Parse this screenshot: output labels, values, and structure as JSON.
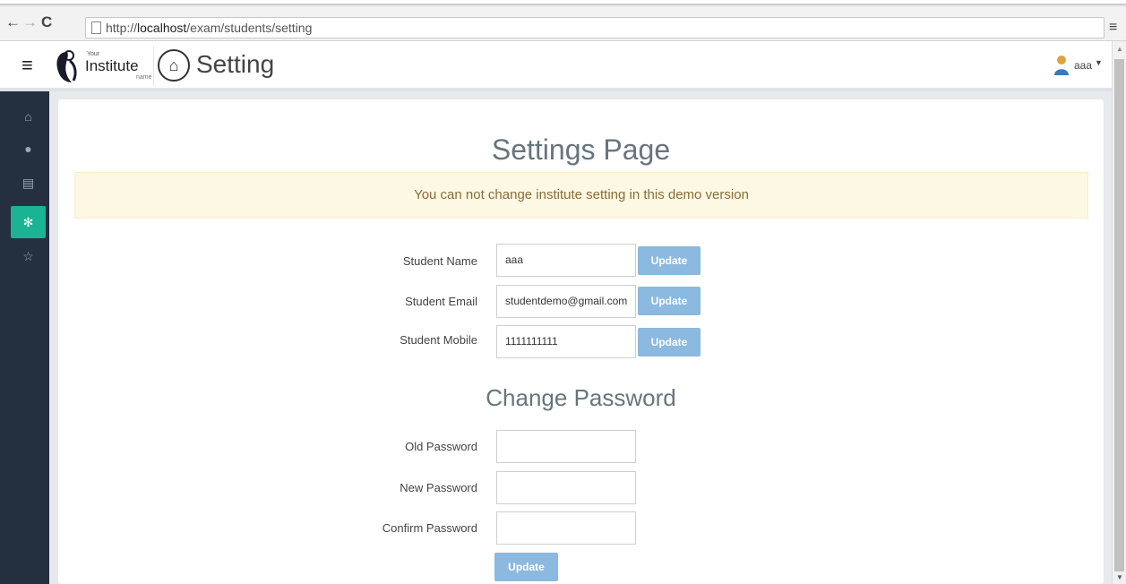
{
  "browser": {
    "url_prefix": "http://",
    "url_host": "localhost",
    "url_path": "/exam/students/setting"
  },
  "header": {
    "logo_top": "Your",
    "logo_name": "Institute",
    "logo_sub": "name",
    "page_title": "Setting",
    "user_name": "aaa"
  },
  "sidebar": {
    "items": [
      {
        "icon": "home-icon",
        "glyph": "⌂"
      },
      {
        "icon": "user-icon",
        "glyph": "👤"
      },
      {
        "icon": "list-icon",
        "glyph": "▤"
      },
      {
        "icon": "gear-icon",
        "glyph": "✻",
        "active": true
      },
      {
        "icon": "star-icon",
        "glyph": "☆"
      }
    ]
  },
  "main": {
    "title": "Settings Page",
    "alert": "You can not change institute setting in this demo version",
    "profile": {
      "name_label": "Student Name",
      "name_value": "aaa",
      "email_label": "Student Email",
      "email_value": "studentdemo@gmail.com",
      "mobile_label": "Student Mobile",
      "mobile_value": "1111111111",
      "update_label": "Update"
    },
    "password": {
      "title": "Change Password",
      "old_label": "Old Password",
      "new_label": "New Password",
      "confirm_label": "Confirm Password",
      "update_label": "Update"
    }
  },
  "colors": {
    "sidebar_bg": "#243040",
    "active_accent": "#1ab394",
    "button_bg": "#8bb9e0",
    "alert_bg": "#fcf8e3"
  }
}
